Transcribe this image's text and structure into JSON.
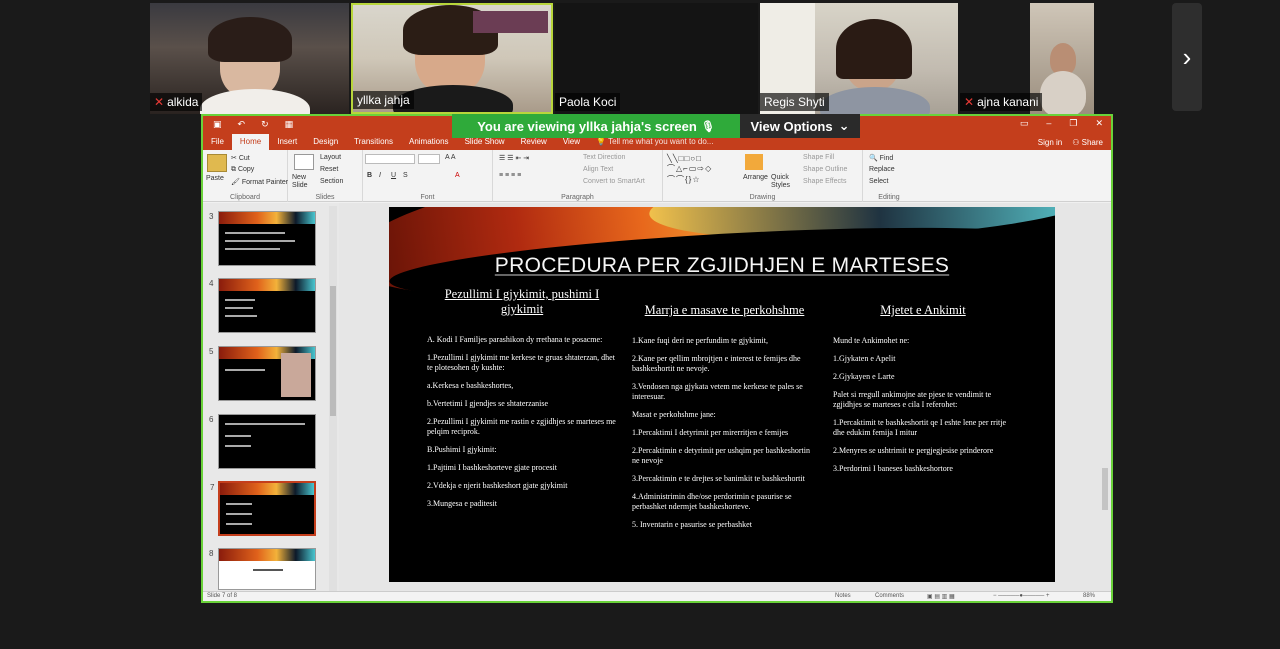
{
  "participants": [
    {
      "name": "alkida",
      "muted": true
    },
    {
      "name": "yllka jahja",
      "muted": false
    },
    {
      "name": "Paola Koci",
      "muted": false
    },
    {
      "name": "Regis Shyti",
      "muted": false
    },
    {
      "name": "ajna kanani",
      "muted": true
    }
  ],
  "share": {
    "banner_text": "You are viewing  yllka jahja's screen",
    "view_options_label": "View Options"
  },
  "ppt": {
    "tabs": [
      "File",
      "Home",
      "Insert",
      "Design",
      "Transitions",
      "Animations",
      "Slide Show",
      "Review",
      "View"
    ],
    "tell_me": "Tell me what you want to do...",
    "sign_in": "Sign in",
    "share": "Share",
    "ribbon": {
      "paste": "Paste",
      "cut": "Cut",
      "copy": "Copy",
      "format_painter": "Format Painter",
      "clipboard": "Clipboard",
      "new_slide": "New Slide",
      "layout": "Layout",
      "reset": "Reset",
      "section": "Section",
      "slides": "Slides",
      "font": "Font",
      "paragraph": "Paragraph",
      "text_direction": "Text Direction",
      "align_text": "Align Text",
      "convert_smartart": "Convert to SmartArt",
      "arrange": "Arrange",
      "quick_styles": "Quick Styles",
      "shape_fill": "Shape Fill",
      "shape_outline": "Shape Outline",
      "shape_effects": "Shape Effects",
      "drawing": "Drawing",
      "find": "Find",
      "replace": "Replace",
      "select": "Select",
      "editing": "Editing"
    },
    "thumb_numbers": [
      "3",
      "4",
      "5",
      "6",
      "7",
      "8"
    ],
    "status": {
      "slide_of": "Slide 7 of 8",
      "notes": "Notes",
      "comments": "Comments",
      "zoom": "88%"
    }
  },
  "slide": {
    "title": "PROCEDURA PER ZGJIDHJEN E MARTESES",
    "col1": {
      "heading": "Pezullimi I gjykimit, pushimi I gjykimit",
      "items": [
        "A.    Kodi I Familjes parashikon dy rrethana te posacme:",
        "1.Pezullimi I gjykimit me kerkese te gruas shtaterzan, dhet te plotesohen dy kushte:",
        "a.Kerkesa e bashkeshortes,",
        "b.Vertetimi I gjendjes se shtaterzanise",
        "2.Pezullimi I gjykimit me rastin e zgjidhjes se marteses me pelqim reciprok.",
        "B.Pushimi I gjykimit:",
        "1.Pajtimi I bashkeshorteve gjate procesit",
        "2.Vdekja e njerit bashkeshort gjate gjykimit",
        "3.Mungesa e paditesit"
      ]
    },
    "col2": {
      "heading": "Marrja e masave te perkohshme",
      "items": [
        "1.Kane fuqi deri ne perfundim te gjykimit,",
        "2.Kane per qellim mbrojtjen e interest te femijes dhe bashkeshortit ne nevoje.",
        "3.Vendosen nga gjykata vetem me kerkese te pales se interesuar.",
        "Masat e perkohshme jane:",
        "1.Percaktimi I detyrimit per mirerritjen e femijes",
        "2.Percaktimin e detyrimit per ushqim per bashkeshortin ne nevoje",
        "3.Percaktimin e te drejtes se banimkit te bashkeshortit",
        "4.Administrimin dhe/ose perdorimin e pasurise se perbashket ndermjet bashkeshorteve.",
        "5. Inventarin e pasurise se perbashket"
      ]
    },
    "col3": {
      "heading": "Mjetet e Ankimit",
      "items": [
        "Mund te Ankimohet ne:",
        "1.Gjykaten e Apelit",
        "2.Gjykayen e Larte",
        "Palet si rregull ankimojne ate pjese te vendimit te zgjidhjes se marteses e cila I referohet:",
        "1.Percaktimit te bashkeshortit qe I eshte lene per rritje dhe edukim femija I mitur",
        "2.Menyres se ushtrimit te pergjegjesise prinderore",
        "3.Perdorimi I baneses bashkeshortore"
      ]
    }
  }
}
